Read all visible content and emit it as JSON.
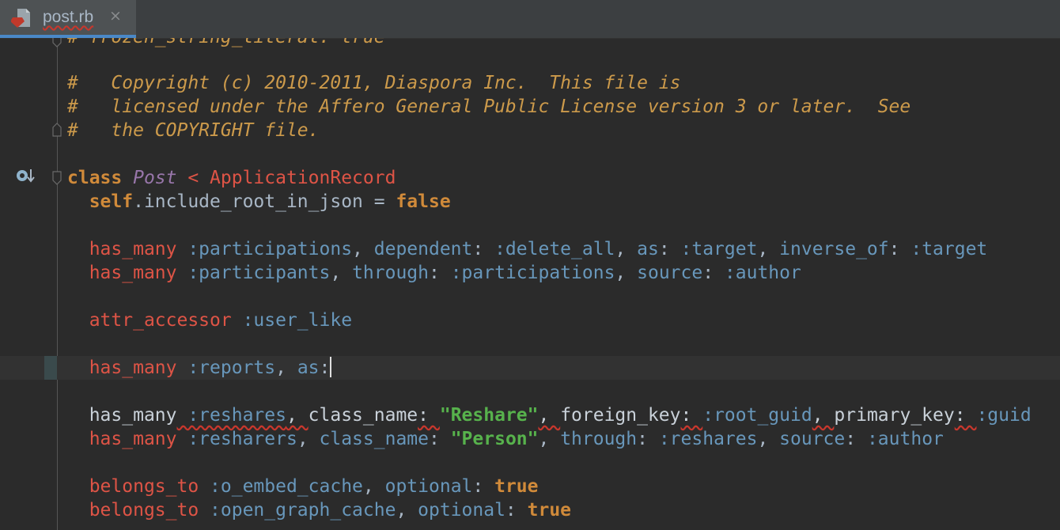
{
  "tab": {
    "title": "post.rb",
    "close_symbol": "×",
    "icon": "ruby-file-icon"
  },
  "colors": {
    "background": "#2b2b2b",
    "comment": "#cc9a4b",
    "keyword": "#d08a3a",
    "method_call": "#de5446",
    "symbol": "#6897bb",
    "string": "#57b24c",
    "tab_underline": "#4a88c7"
  },
  "editor": {
    "line_top": {
      "comment": "# frozen_string_literal: true"
    },
    "line_comment1": {
      "hash": "#",
      "text": "   Copyright (c) 2010-2011, Diaspora Inc.  This file is"
    },
    "line_comment2": {
      "hash": "#",
      "text": "   licensed under the Affero General Public License version 3 or later.  See"
    },
    "line_comment3": {
      "hash": "#",
      "text": "   the COPYRIGHT file."
    },
    "line_class": {
      "kw": "class",
      "name": "Post",
      "lt": " < ",
      "parent": "ApplicationRecord"
    },
    "line_self": {
      "kw_self": "self",
      "text": ".include_root_in_json = ",
      "kw_false": "false"
    },
    "line_hm1": {
      "call": "has_many",
      "sym": " :participations",
      "p1": ", ",
      "k1": "dependent",
      "p2": ": ",
      "s1": ":delete_all",
      "p3": ", ",
      "k2": "as",
      "p4": ": ",
      "s2": ":target",
      "p5": ", ",
      "k3": "inverse_of",
      "p6": ": ",
      "s3": ":target"
    },
    "line_hm2": {
      "call": "has_many",
      "sym": " :participants",
      "p1": ", ",
      "k1": "through",
      "p2": ": ",
      "s1": ":participations",
      "p3": ", ",
      "k2": "source",
      "p4": ": ",
      "s2": ":author"
    },
    "line_attr": {
      "call": "attr_accessor",
      "sym": " :user_like"
    },
    "line_reports": {
      "call": "has_many",
      "sym": " :reports",
      "p1": ", ",
      "k1": "as",
      "p2": ":"
    },
    "line_reshares": {
      "call": "has_many",
      "s0": " :reshares",
      "p1": ", ",
      "k1": "class_name",
      "p2": ": ",
      "str": "\"Reshare\"",
      "p3": ", ",
      "k2": "foreign_key",
      "p4": ": ",
      "s1": ":root_guid",
      "p5": ", ",
      "k3": "primary_key",
      "p6": ": ",
      "s2": ":guid"
    },
    "line_resharers": {
      "call": "has_many",
      "sym": " :resharers",
      "p1": ", ",
      "k1": "class_name",
      "p2": ": ",
      "str": "\"Person\"",
      "p3": ", ",
      "k2": "through",
      "p4": ": ",
      "s1": ":reshares",
      "p5": ", ",
      "k3": "source",
      "p6": ": ",
      "s2": ":author"
    },
    "line_bt1": {
      "call": "belongs_to",
      "sym": " :o_embed_cache",
      "p1": ", ",
      "k1": "optional",
      "p2": ": ",
      "kw": "true"
    },
    "line_bt2": {
      "call": "belongs_to",
      "sym": " :open_graph_cache",
      "p1": ", ",
      "k1": "optional",
      "p2": ": ",
      "kw": "true"
    }
  }
}
